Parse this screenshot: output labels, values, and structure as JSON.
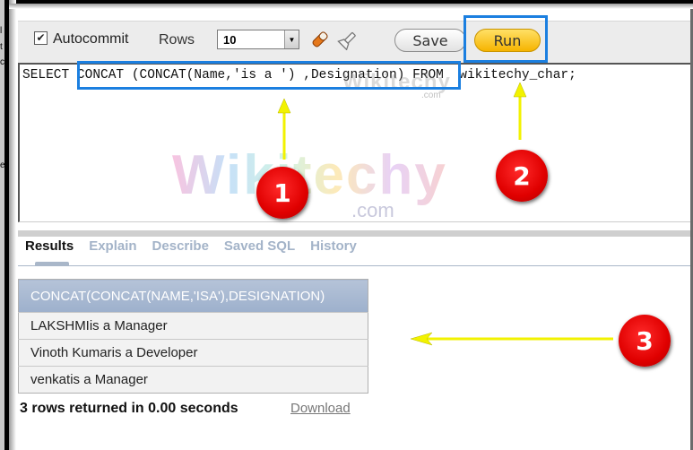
{
  "toolbar": {
    "autocommit_label": "Autocommit",
    "autocommit_checked": true,
    "check_glyph": "✔",
    "rows_label": "Rows",
    "rows_value": "10",
    "dropdown_glyph": "▼",
    "save_label": "Save",
    "run_label": "Run"
  },
  "editor": {
    "sql": "SELECT CONCAT (CONCAT(Name,'is a ') ,Designation) FROM  wikitechy_char;"
  },
  "watermark": {
    "brand": "Wikitechy",
    "domain": ".com"
  },
  "annotations": {
    "badge1": "1",
    "badge2": "2",
    "badge3": "3",
    "arrow_color": "#ffff00",
    "highlight_color": "#1b7fe0",
    "badge_color": "#e00000"
  },
  "tabs": [
    {
      "label": "Results",
      "active": true
    },
    {
      "label": "Explain",
      "active": false
    },
    {
      "label": "Describe",
      "active": false
    },
    {
      "label": "Saved SQL",
      "active": false
    },
    {
      "label": "History",
      "active": false
    }
  ],
  "results": {
    "columns": [
      "CONCAT(CONCAT(NAME,'ISA'),DESIGNATION)"
    ],
    "rows": [
      [
        "LAKSHMIis a Manager"
      ],
      [
        "Vinoth Kumaris a Developer"
      ],
      [
        "venkatis a Manager"
      ]
    ],
    "status": "3 rows returned in 0.00 seconds",
    "download_label": "Download"
  },
  "left_stray_chars": [
    "l",
    "t",
    "c",
    "e"
  ]
}
